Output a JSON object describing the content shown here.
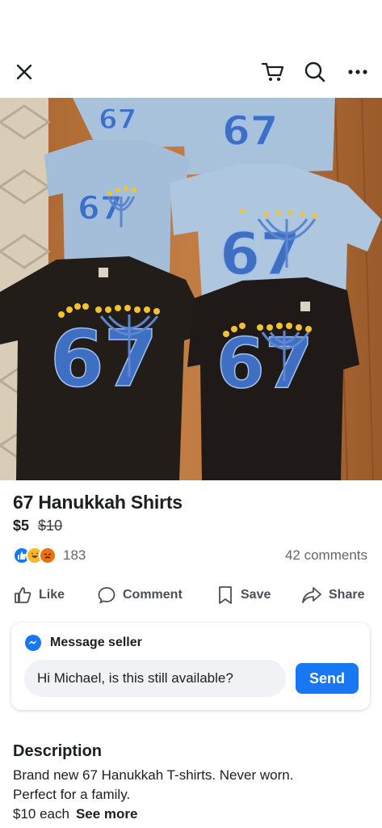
{
  "header": {
    "close_icon": "close-icon",
    "cart_icon": "cart-icon",
    "search_icon": "search-icon",
    "more_icon": "more-options-icon"
  },
  "listing": {
    "title": "67 Hanukkah Shirts",
    "price": "$5",
    "original_price": "$10",
    "reactions": [
      "like",
      "haha",
      "angry"
    ],
    "reaction_count": "183",
    "comments_count": "42 comments",
    "photo_text": "67"
  },
  "actions": {
    "like": "Like",
    "comment": "Comment",
    "save": "Save",
    "share": "Share"
  },
  "message": {
    "header": "Message seller",
    "input_value": "Hi Michael, is this still available?",
    "send_label": "Send"
  },
  "description": {
    "title": "Description",
    "line1": "Brand new 67 Hanukkah T-shirts. Never worn.",
    "line2": "Perfect for a family.",
    "line3": "$10 each",
    "see_more": "See more"
  },
  "colors": {
    "accent": "#1877f2",
    "shirt_light": "#a9c2dc",
    "shirt_dark": "#1f1a17",
    "floor": "#b5713a",
    "print_blue": "#3f6fc2",
    "flame": "#f2c230"
  }
}
